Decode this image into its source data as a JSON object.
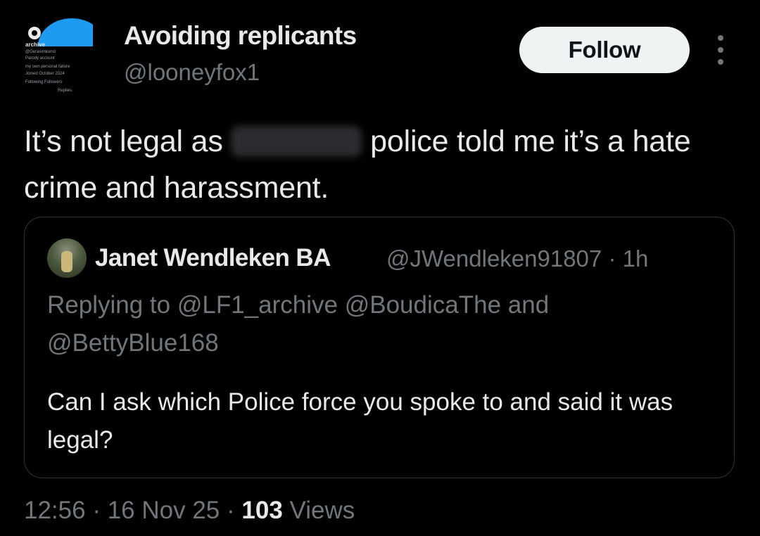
{
  "tweet": {
    "avatar": {
      "lines": [
        "archive",
        "@Gerasimkunst",
        "Parody account",
        "my own personal failure",
        "Joined October 2024",
        "Following  Followers",
        "Replies"
      ]
    },
    "author_name": "Avoiding replicants",
    "author_handle": "@looneyfox1",
    "follow_label": "Follow",
    "more_icon": "more-dots-vertical-icon",
    "text_before": "It’s not legal as",
    "text_after": "police told me it’s a hate crime and harassment.",
    "quoted": {
      "author_name": "Janet Wendleken BA",
      "author_handle": "@JWendleken91807",
      "separator": "·",
      "time_ago": "1h",
      "replying_prefix": "Replying to",
      "mention_1": "@LF1_archive",
      "mention_2": "@BoudicaThe",
      "and_word": "and",
      "mention_3": "@BettyBlue168",
      "text": "Can I ask which Police force you spoke to and said it was legal?"
    },
    "footer": {
      "time": "12:56",
      "dot": "·",
      "date": "16 Nov 25",
      "views_count": "103",
      "views_label": "Views"
    }
  },
  "colors": {
    "background": "#000000",
    "primary_text": "#e7e9ea",
    "secondary_text": "#71767b",
    "border": "#2f3336",
    "follow_button_bg": "#eff3f4",
    "follow_button_text": "#0f1419",
    "accent": "#1d9bf0"
  }
}
